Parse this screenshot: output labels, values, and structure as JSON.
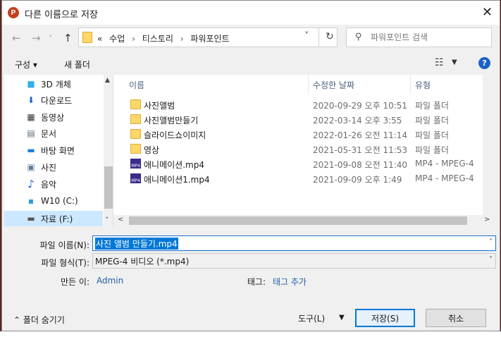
{
  "window": {
    "app_icon": "P",
    "title": "다른 이름으로 저장",
    "close": "✕"
  },
  "nav": {
    "back": "←",
    "forward": "→",
    "dropdown": "˅",
    "up": "↑"
  },
  "address": {
    "prefix": "«",
    "crumbs": [
      "수업",
      "티스토리",
      "파워포인트"
    ],
    "separator": "›",
    "dropdown": "˅",
    "refresh": "↻"
  },
  "search": {
    "placeholder": "파워포인트 검색"
  },
  "toolbar": {
    "organize": "구성 ▾",
    "new_folder": "새 폴더",
    "view": "☷",
    "view_dd": "▼",
    "help": "?"
  },
  "sidebar": {
    "items": [
      {
        "label": "3D 개체",
        "icon": "cube-icon",
        "glyph": "■",
        "color": "#2fb0e8"
      },
      {
        "label": "다운로드",
        "icon": "download-icon",
        "glyph": "⬇",
        "color": "#1d62c8"
      },
      {
        "label": "동영상",
        "icon": "film-icon",
        "glyph": "▦",
        "color": "#333333"
      },
      {
        "label": "문서",
        "icon": "document-icon",
        "glyph": "▤",
        "color": "#5a6b7a"
      },
      {
        "label": "바탕 화면",
        "icon": "desktop-icon",
        "glyph": "▬",
        "color": "#1d7fd8"
      },
      {
        "label": "사진",
        "icon": "picture-icon",
        "glyph": "▣",
        "color": "#5a7a9a"
      },
      {
        "label": "음악",
        "icon": "music-icon",
        "glyph": "♪",
        "color": "#1d62c8"
      },
      {
        "label": "W10 (C:)",
        "icon": "windows-drive-icon",
        "glyph": "▪",
        "color": "#2a9bd8"
      },
      {
        "label": "자료 (F:)",
        "icon": "drive-icon",
        "glyph": "▬",
        "color": "#555555"
      }
    ],
    "scroll_up": "▲",
    "scroll_down": "˅"
  },
  "files": {
    "columns": {
      "name": "이름",
      "date": "수정한 날짜",
      "type": "유형"
    },
    "sort_arrow": "˄",
    "rows": [
      {
        "name": "사진앨범",
        "date": "2020-09-29 오후 10:51",
        "type": "파일 폴더",
        "kind": "folder"
      },
      {
        "name": "사진앨범만들기",
        "date": "2022-03-14 오후 3:55",
        "type": "파일 폴더",
        "kind": "folder"
      },
      {
        "name": "슬라이드쇼이미지",
        "date": "2022-01-26 오전 11:14",
        "type": "파일 폴더",
        "kind": "folder"
      },
      {
        "name": "영상",
        "date": "2021-05-31 오전 11:53",
        "type": "파일 폴더",
        "kind": "folder"
      },
      {
        "name": "애니메이션.mp4",
        "date": "2021-09-08 오전 11:40",
        "type": "MP4 - MPEG-4",
        "kind": "video"
      },
      {
        "name": "애니메이션1.mp4",
        "date": "2021-09-09 오후 1:49",
        "type": "MP4 - MPEG-4",
        "kind": "video"
      }
    ],
    "video_badge": "MP4",
    "scroll_left": "<",
    "scroll_right": ">"
  },
  "form": {
    "filename_label": "파일 이름(N):",
    "filename_value": "사진 앨범 만들기.mp4",
    "filetype_label": "파일 형식(T):",
    "filetype_value": "MPEG-4 비디오 (*.mp4)",
    "dropdown": "˅",
    "author_label": "만든 이:",
    "author_value": "Admin",
    "tags_label": "태그:",
    "tags_value": "태그 추가"
  },
  "footer": {
    "hide_folders": "⌃  폴더 숨기기",
    "tools": "도구(L)",
    "tools_dd": "▼",
    "save": "저장(S)",
    "cancel": "취소"
  }
}
